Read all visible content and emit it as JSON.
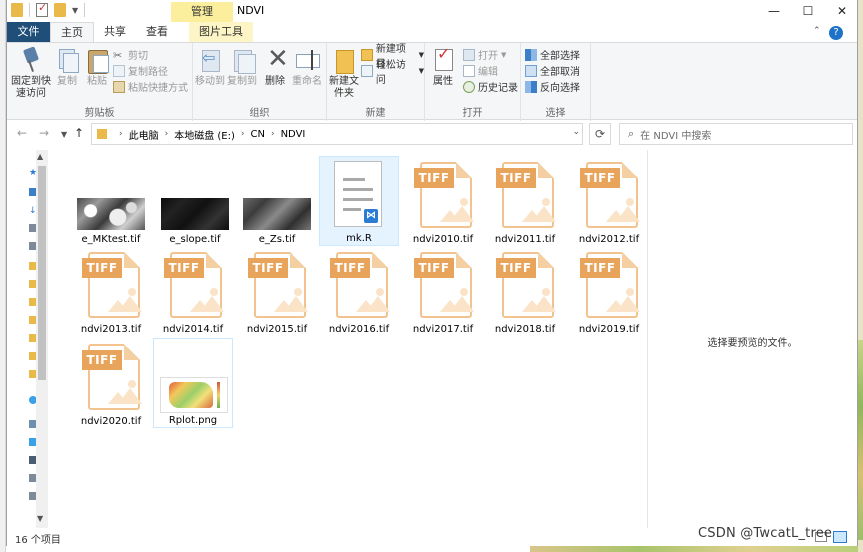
{
  "window": {
    "title": "NDVI",
    "context_tab_group": "管理",
    "controls": {
      "minimize": "—",
      "maximize": "☐",
      "close": "✕"
    }
  },
  "ribbon_tabs": [
    "文件",
    "主页",
    "共享",
    "查看",
    "图片工具"
  ],
  "ribbon": {
    "clipboard": {
      "label": "剪贴板",
      "pin": "固定到快速访问",
      "copy": "复制",
      "paste": "粘贴",
      "cut": "剪切",
      "copy_path": "复制路径",
      "paste_shortcut": "粘贴快捷方式"
    },
    "organize": {
      "label": "组织",
      "move_to": "移动到",
      "copy_to": "复制到",
      "delete": "删除",
      "rename": "重命名"
    },
    "new": {
      "label": "新建",
      "new_folder": "新建文件夹",
      "new_item": "新建项目",
      "easy_access": "轻松访问"
    },
    "open": {
      "label": "打开",
      "properties": "属性",
      "open": "打开",
      "edit": "编辑",
      "history": "历史记录"
    },
    "select": {
      "label": "选择",
      "select_all": "全部选择",
      "select_none": "全部取消",
      "invert": "反向选择"
    }
  },
  "address": {
    "crumbs": [
      "此电脑",
      "本地磁盘 (E:)",
      "CN",
      "NDVI"
    ],
    "search_placeholder": "在 NDVI 中搜索"
  },
  "files": [
    {
      "name": "e_MKtest.tif",
      "kind": "raster-thumb-mk"
    },
    {
      "name": "e_slope.tif",
      "kind": "raster-thumb-slope"
    },
    {
      "name": "e_Zs.tif",
      "kind": "raster-thumb-zs"
    },
    {
      "name": "mk.R",
      "kind": "r-script",
      "selected": true
    },
    {
      "name": "ndvi2010.tif",
      "kind": "tiff"
    },
    {
      "name": "ndvi2011.tif",
      "kind": "tiff"
    },
    {
      "name": "ndvi2012.tif",
      "kind": "tiff"
    },
    {
      "name": "ndvi2013.tif",
      "kind": "tiff"
    },
    {
      "name": "ndvi2014.tif",
      "kind": "tiff"
    },
    {
      "name": "ndvi2015.tif",
      "kind": "tiff"
    },
    {
      "name": "ndvi2016.tif",
      "kind": "tiff"
    },
    {
      "name": "ndvi2017.tif",
      "kind": "tiff"
    },
    {
      "name": "ndvi2018.tif",
      "kind": "tiff"
    },
    {
      "name": "ndvi2019.tif",
      "kind": "tiff"
    },
    {
      "name": "ndvi2020.tif",
      "kind": "tiff"
    },
    {
      "name": "Rplot.png",
      "kind": "png-thumb",
      "hovered": true
    }
  ],
  "tiff_badge": "TIFF",
  "preview": {
    "message": "选择要预览的文件。"
  },
  "status": {
    "count": "16 个项目"
  },
  "watermark": "CSDN @TwcatL_tree",
  "colors": {
    "file_tab": "#1f4e79",
    "context_tab": "#fbef9d",
    "selection": "#e5f3ff",
    "tiff_accent": "#e9a45c"
  }
}
